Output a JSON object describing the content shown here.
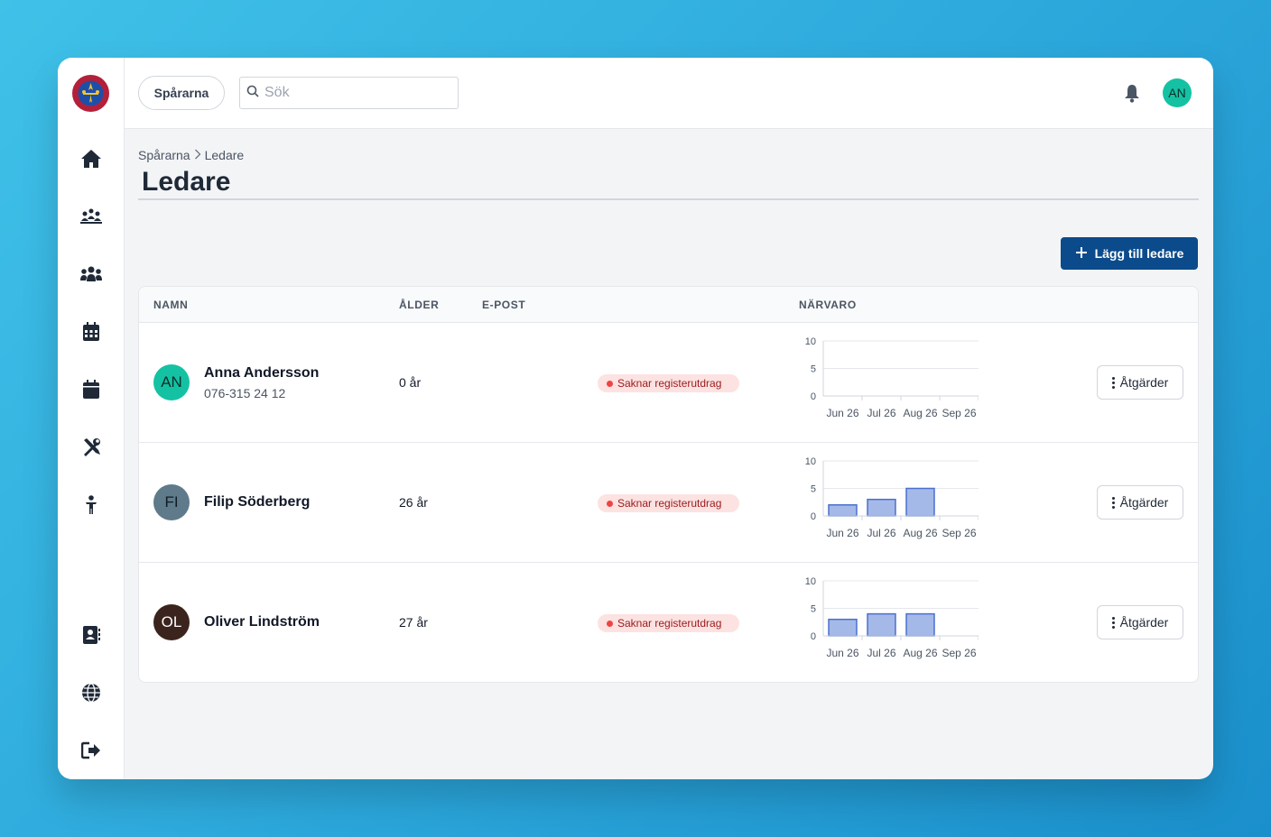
{
  "org_button": "Spårarna",
  "search": {
    "placeholder": "Sök"
  },
  "top_avatar": "AN",
  "breadcrumb": {
    "root": "Spårarna",
    "current": "Ledare"
  },
  "page_title": "Ledare",
  "add_button": "Lägg till ledare",
  "columns": {
    "name": "NAMN",
    "age": "ÅLDER",
    "email": "E-POST",
    "attendance": "NÄRVARO"
  },
  "colors": {
    "primary": "#0b4b8c",
    "teal_avatar": "#14c2a3",
    "bar_fill": "#a5b9e8",
    "bar_stroke": "#4a6fcf",
    "badge_bg": "#fde2e2"
  },
  "sidebar_icons": [
    "home-icon",
    "campfire-group-icon",
    "people-icon",
    "calendar-grid-icon",
    "calendar-icon",
    "tools-icon",
    "child-icon",
    "contact-card-icon",
    "globe-icon",
    "logout-icon"
  ],
  "leaders": [
    {
      "initials": "AN",
      "name": "Anna Andersson",
      "phone": "076-315 24 12",
      "age": "0 år",
      "badge": "Saknar registerutdrag",
      "avatar_bg": "#14c2a3",
      "avatar_fg": "#0b2e2a",
      "actions": "Åtgärder"
    },
    {
      "initials": "FI",
      "name": "Filip Söderberg",
      "phone": "",
      "age": "26 år",
      "badge": "Saknar registerutdrag",
      "avatar_bg": "#5f7a8a",
      "avatar_fg": "#0f1d24",
      "actions": "Åtgärder"
    },
    {
      "initials": "OL",
      "name": "Oliver Lindström",
      "phone": "",
      "age": "27 år",
      "badge": "Saknar registerutdrag",
      "avatar_bg": "#3b241d",
      "avatar_fg": "#ffffff",
      "actions": "Åtgärder"
    }
  ],
  "chart_data": [
    {
      "type": "bar",
      "categories": [
        "Jun 26",
        "Jul 26",
        "Aug 26",
        "Sep 26"
      ],
      "values": [
        0,
        0,
        0,
        0
      ],
      "ylim": [
        0,
        10
      ],
      "yticks": [
        "10",
        "5",
        "0"
      ]
    },
    {
      "type": "bar",
      "categories": [
        "Jun 26",
        "Jul 26",
        "Aug 26",
        "Sep 26"
      ],
      "values": [
        2,
        3,
        5,
        0
      ],
      "ylim": [
        0,
        10
      ],
      "yticks": [
        "10",
        "5",
        "0"
      ]
    },
    {
      "type": "bar",
      "categories": [
        "Jun 26",
        "Jul 26",
        "Aug 26",
        "Sep 26"
      ],
      "values": [
        3,
        4,
        4,
        0
      ],
      "ylim": [
        0,
        10
      ],
      "yticks": [
        "10",
        "5",
        "0"
      ]
    }
  ]
}
